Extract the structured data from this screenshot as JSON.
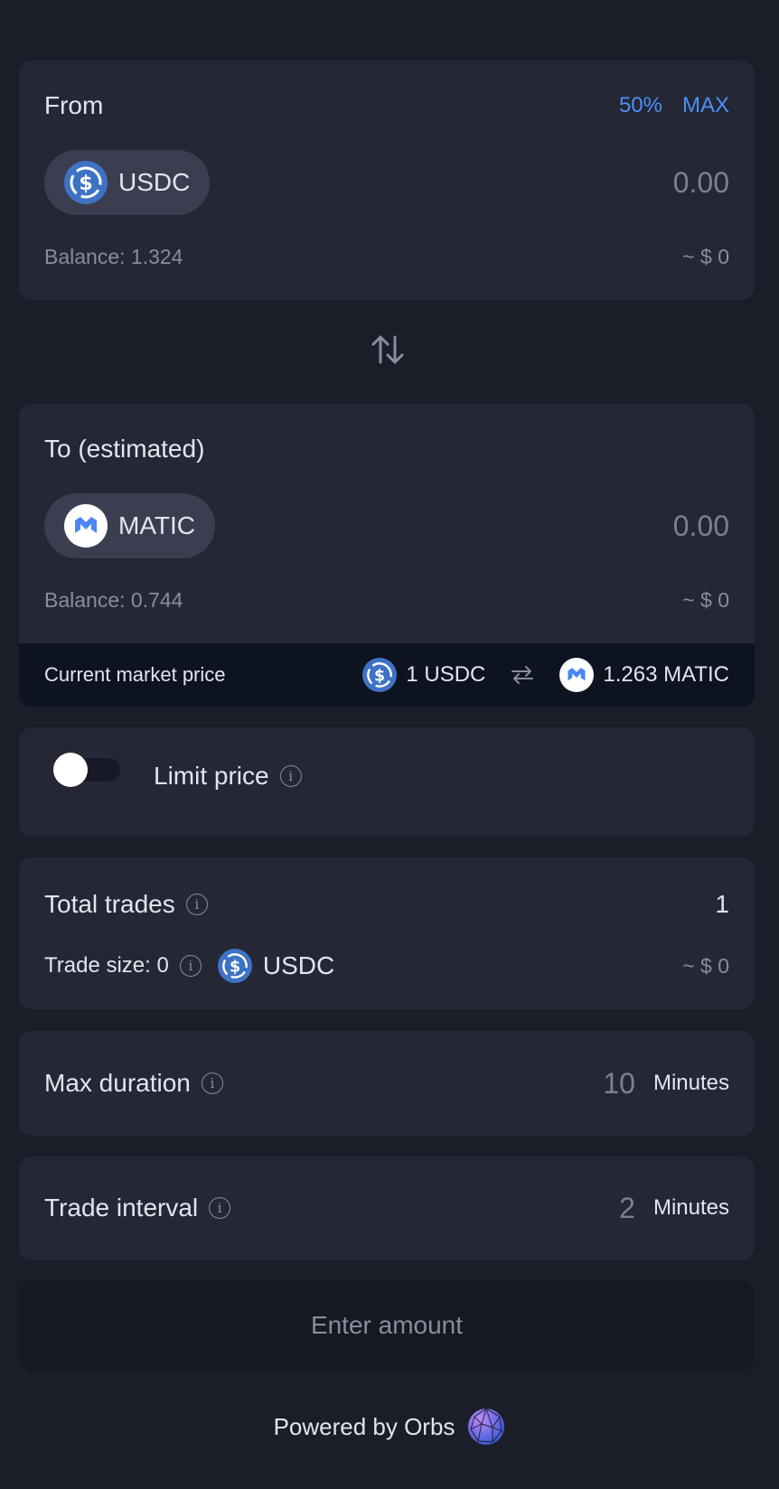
{
  "from": {
    "label": "From",
    "pct50": "50%",
    "max": "MAX",
    "token": "USDC",
    "amount": "0.00",
    "balance": "Balance: 1.324",
    "usd": "~ $ 0"
  },
  "to": {
    "label": "To (estimated)",
    "token": "MATIC",
    "amount": "0.00",
    "balance": "Balance: 0.744",
    "usd": "~ $ 0"
  },
  "market": {
    "label": "Current market price",
    "left": "1 USDC",
    "right": "1.263 MATIC"
  },
  "limit": {
    "label": "Limit price",
    "enabled": false
  },
  "trades": {
    "label": "Total trades",
    "value": "1",
    "size_label": "Trade size: 0",
    "size_token": "USDC",
    "usd": "~ $ 0"
  },
  "duration": {
    "label": "Max duration",
    "value": "10",
    "unit": "Minutes"
  },
  "interval": {
    "label": "Trade interval",
    "value": "2",
    "unit": "Minutes"
  },
  "button": {
    "label": "Enter amount"
  },
  "footer": {
    "text": "Powered by Orbs"
  },
  "colors": {
    "background": "#1b1d29",
    "card": "#252735",
    "accent": "#4e8ff7",
    "usdc": "#3e73c4",
    "matic": "#4b86f2"
  },
  "icons": {
    "swap": "swap-arrows-icon",
    "info": "info-icon",
    "orbs": "orbs-logo-icon"
  }
}
